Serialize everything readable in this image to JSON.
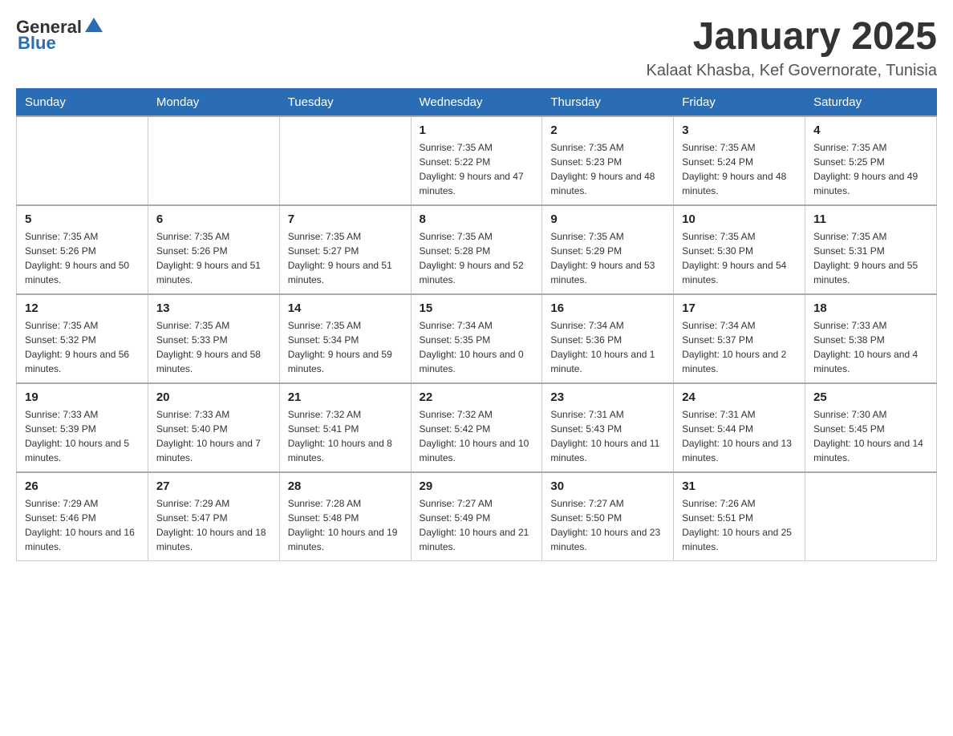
{
  "header": {
    "logo": {
      "general": "General",
      "blue": "Blue"
    },
    "title": "January 2025",
    "location": "Kalaat Khasba, Kef Governorate, Tunisia"
  },
  "weekdays": [
    "Sunday",
    "Monday",
    "Tuesday",
    "Wednesday",
    "Thursday",
    "Friday",
    "Saturday"
  ],
  "weeks": [
    [
      {
        "day": "",
        "info": ""
      },
      {
        "day": "",
        "info": ""
      },
      {
        "day": "",
        "info": ""
      },
      {
        "day": "1",
        "info": "Sunrise: 7:35 AM\nSunset: 5:22 PM\nDaylight: 9 hours and 47 minutes."
      },
      {
        "day": "2",
        "info": "Sunrise: 7:35 AM\nSunset: 5:23 PM\nDaylight: 9 hours and 48 minutes."
      },
      {
        "day": "3",
        "info": "Sunrise: 7:35 AM\nSunset: 5:24 PM\nDaylight: 9 hours and 48 minutes."
      },
      {
        "day": "4",
        "info": "Sunrise: 7:35 AM\nSunset: 5:25 PM\nDaylight: 9 hours and 49 minutes."
      }
    ],
    [
      {
        "day": "5",
        "info": "Sunrise: 7:35 AM\nSunset: 5:26 PM\nDaylight: 9 hours and 50 minutes."
      },
      {
        "day": "6",
        "info": "Sunrise: 7:35 AM\nSunset: 5:26 PM\nDaylight: 9 hours and 51 minutes."
      },
      {
        "day": "7",
        "info": "Sunrise: 7:35 AM\nSunset: 5:27 PM\nDaylight: 9 hours and 51 minutes."
      },
      {
        "day": "8",
        "info": "Sunrise: 7:35 AM\nSunset: 5:28 PM\nDaylight: 9 hours and 52 minutes."
      },
      {
        "day": "9",
        "info": "Sunrise: 7:35 AM\nSunset: 5:29 PM\nDaylight: 9 hours and 53 minutes."
      },
      {
        "day": "10",
        "info": "Sunrise: 7:35 AM\nSunset: 5:30 PM\nDaylight: 9 hours and 54 minutes."
      },
      {
        "day": "11",
        "info": "Sunrise: 7:35 AM\nSunset: 5:31 PM\nDaylight: 9 hours and 55 minutes."
      }
    ],
    [
      {
        "day": "12",
        "info": "Sunrise: 7:35 AM\nSunset: 5:32 PM\nDaylight: 9 hours and 56 minutes."
      },
      {
        "day": "13",
        "info": "Sunrise: 7:35 AM\nSunset: 5:33 PM\nDaylight: 9 hours and 58 minutes."
      },
      {
        "day": "14",
        "info": "Sunrise: 7:35 AM\nSunset: 5:34 PM\nDaylight: 9 hours and 59 minutes."
      },
      {
        "day": "15",
        "info": "Sunrise: 7:34 AM\nSunset: 5:35 PM\nDaylight: 10 hours and 0 minutes."
      },
      {
        "day": "16",
        "info": "Sunrise: 7:34 AM\nSunset: 5:36 PM\nDaylight: 10 hours and 1 minute."
      },
      {
        "day": "17",
        "info": "Sunrise: 7:34 AM\nSunset: 5:37 PM\nDaylight: 10 hours and 2 minutes."
      },
      {
        "day": "18",
        "info": "Sunrise: 7:33 AM\nSunset: 5:38 PM\nDaylight: 10 hours and 4 minutes."
      }
    ],
    [
      {
        "day": "19",
        "info": "Sunrise: 7:33 AM\nSunset: 5:39 PM\nDaylight: 10 hours and 5 minutes."
      },
      {
        "day": "20",
        "info": "Sunrise: 7:33 AM\nSunset: 5:40 PM\nDaylight: 10 hours and 7 minutes."
      },
      {
        "day": "21",
        "info": "Sunrise: 7:32 AM\nSunset: 5:41 PM\nDaylight: 10 hours and 8 minutes."
      },
      {
        "day": "22",
        "info": "Sunrise: 7:32 AM\nSunset: 5:42 PM\nDaylight: 10 hours and 10 minutes."
      },
      {
        "day": "23",
        "info": "Sunrise: 7:31 AM\nSunset: 5:43 PM\nDaylight: 10 hours and 11 minutes."
      },
      {
        "day": "24",
        "info": "Sunrise: 7:31 AM\nSunset: 5:44 PM\nDaylight: 10 hours and 13 minutes."
      },
      {
        "day": "25",
        "info": "Sunrise: 7:30 AM\nSunset: 5:45 PM\nDaylight: 10 hours and 14 minutes."
      }
    ],
    [
      {
        "day": "26",
        "info": "Sunrise: 7:29 AM\nSunset: 5:46 PM\nDaylight: 10 hours and 16 minutes."
      },
      {
        "day": "27",
        "info": "Sunrise: 7:29 AM\nSunset: 5:47 PM\nDaylight: 10 hours and 18 minutes."
      },
      {
        "day": "28",
        "info": "Sunrise: 7:28 AM\nSunset: 5:48 PM\nDaylight: 10 hours and 19 minutes."
      },
      {
        "day": "29",
        "info": "Sunrise: 7:27 AM\nSunset: 5:49 PM\nDaylight: 10 hours and 21 minutes."
      },
      {
        "day": "30",
        "info": "Sunrise: 7:27 AM\nSunset: 5:50 PM\nDaylight: 10 hours and 23 minutes."
      },
      {
        "day": "31",
        "info": "Sunrise: 7:26 AM\nSunset: 5:51 PM\nDaylight: 10 hours and 25 minutes."
      },
      {
        "day": "",
        "info": ""
      }
    ]
  ]
}
